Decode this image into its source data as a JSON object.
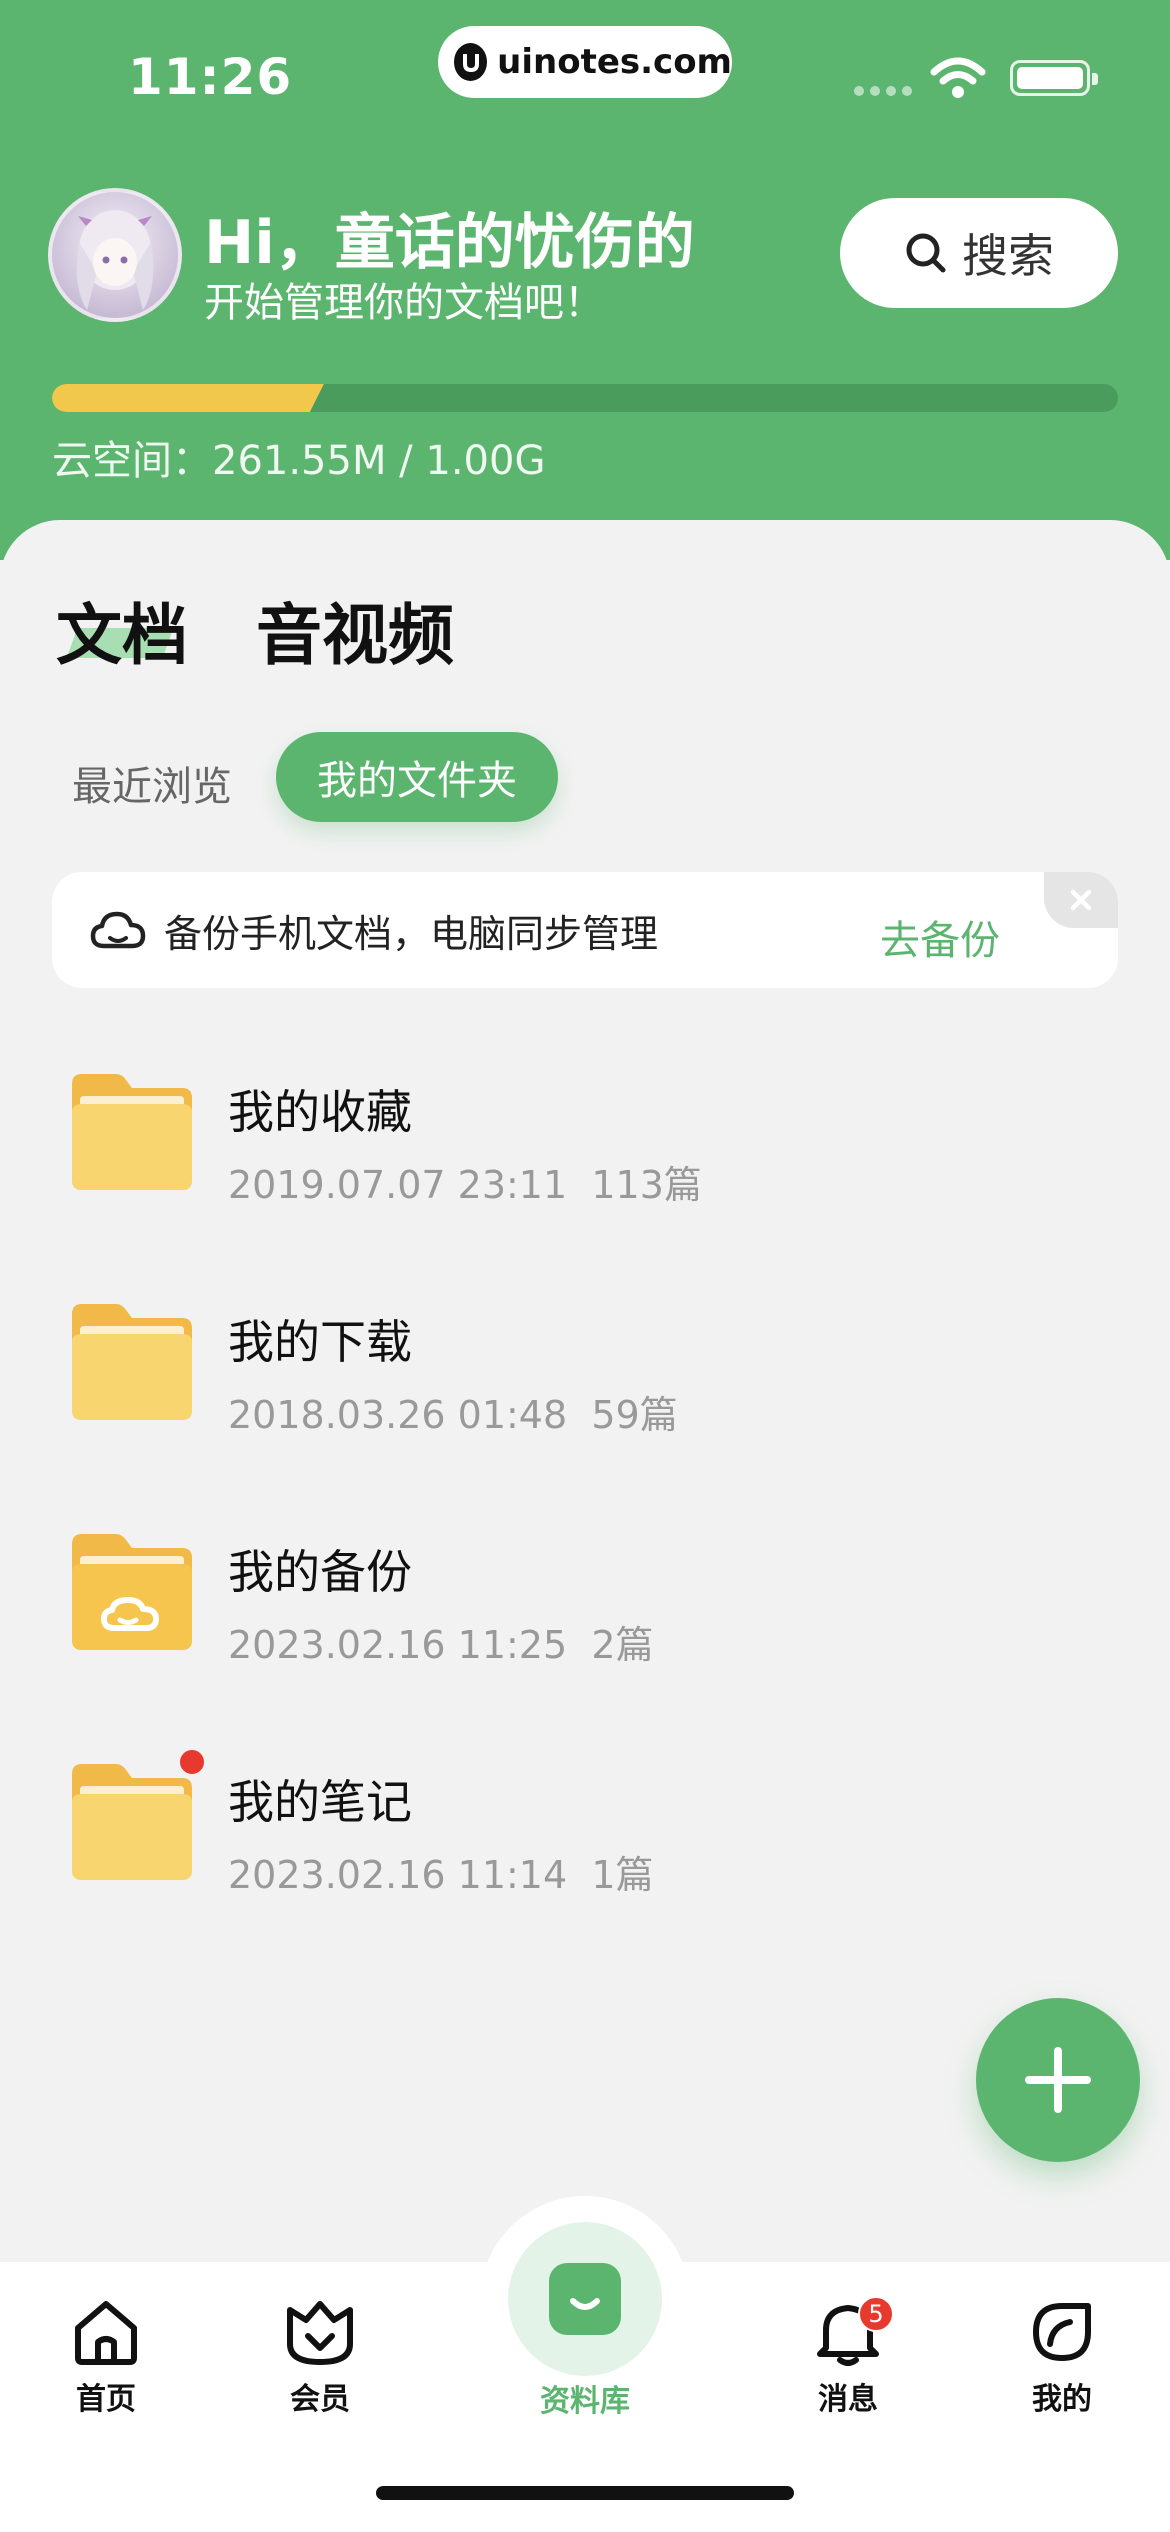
{
  "status_bar": {
    "time": "11:26",
    "url": "uinotes.com"
  },
  "header": {
    "greeting": "Hi，童话的忧伤的",
    "subtitle": "开始管理你的文档吧！",
    "search_label": "搜索",
    "storage_text": "云空间：261.55M / 1.00G",
    "storage_used_fraction": 0.255
  },
  "tabs": [
    {
      "label": "文档",
      "active": true
    },
    {
      "label": "音视频",
      "active": false
    }
  ],
  "subtabs": [
    {
      "label": "最近浏览",
      "active": false
    },
    {
      "label": "我的文件夹",
      "active": true
    }
  ],
  "banner": {
    "text": "备份手机文档，电脑同步管理",
    "action": "去备份"
  },
  "folders": [
    {
      "name": "我的收藏",
      "date": "2019.07.07 23:11",
      "count": "113篇",
      "icon": "folder-icon"
    },
    {
      "name": "我的下载",
      "date": "2018.03.26 01:48",
      "count": "59篇",
      "icon": "folder-icon"
    },
    {
      "name": "我的备份",
      "date": "2023.02.16 11:25",
      "count": "2篇",
      "icon": "cloud-folder-icon"
    },
    {
      "name": "我的笔记",
      "date": "2023.02.16 11:14",
      "count": "1篇",
      "icon": "folder-icon",
      "has_dot": true
    }
  ],
  "nav": {
    "home": "首页",
    "vip": "会员",
    "library": "资料库",
    "messages": "消息",
    "messages_badge": "5",
    "mine": "我的"
  },
  "colors": {
    "brand_green": "#5bb56f",
    "storage_bar": "#f1c84b",
    "folder_yellow": "#f6c54e",
    "badge_red": "#e8392f"
  }
}
